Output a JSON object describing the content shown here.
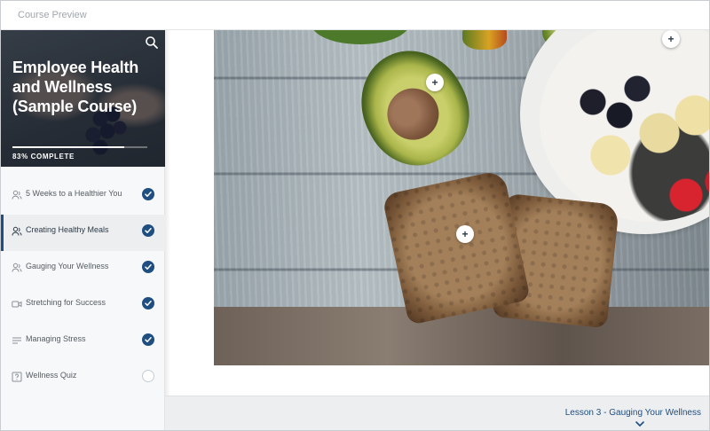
{
  "topbar": {
    "title": "Course Preview"
  },
  "course": {
    "title": "Employee Health and Wellness (Sample Course)",
    "progress_percent": 83,
    "progress_label": "83% COMPLETE"
  },
  "lessons": [
    {
      "label": "5 Weeks to a Healthier You",
      "icon": "people-icon",
      "completed": true,
      "active": false
    },
    {
      "label": "Creating Healthy Meals",
      "icon": "people-icon",
      "completed": true,
      "active": true
    },
    {
      "label": "Gauging Your Wellness",
      "icon": "people-icon",
      "completed": true,
      "active": false
    },
    {
      "label": "Stretching for Success",
      "icon": "video-icon",
      "completed": true,
      "active": false
    },
    {
      "label": "Managing Stress",
      "icon": "text-lines-icon",
      "completed": true,
      "active": false
    },
    {
      "label": "Wellness Quiz",
      "icon": "quiz-icon",
      "completed": false,
      "active": false
    }
  ],
  "hotspots": [
    {
      "label": "+"
    },
    {
      "label": "+"
    },
    {
      "label": "+"
    }
  ],
  "footer": {
    "next_lesson_label": "Lesson 3 - Gauging Your Wellness"
  },
  "colors": {
    "accent": "#1f4e80",
    "sidebar_bg": "#f7f8f9",
    "footer_bg": "#eceeef"
  }
}
